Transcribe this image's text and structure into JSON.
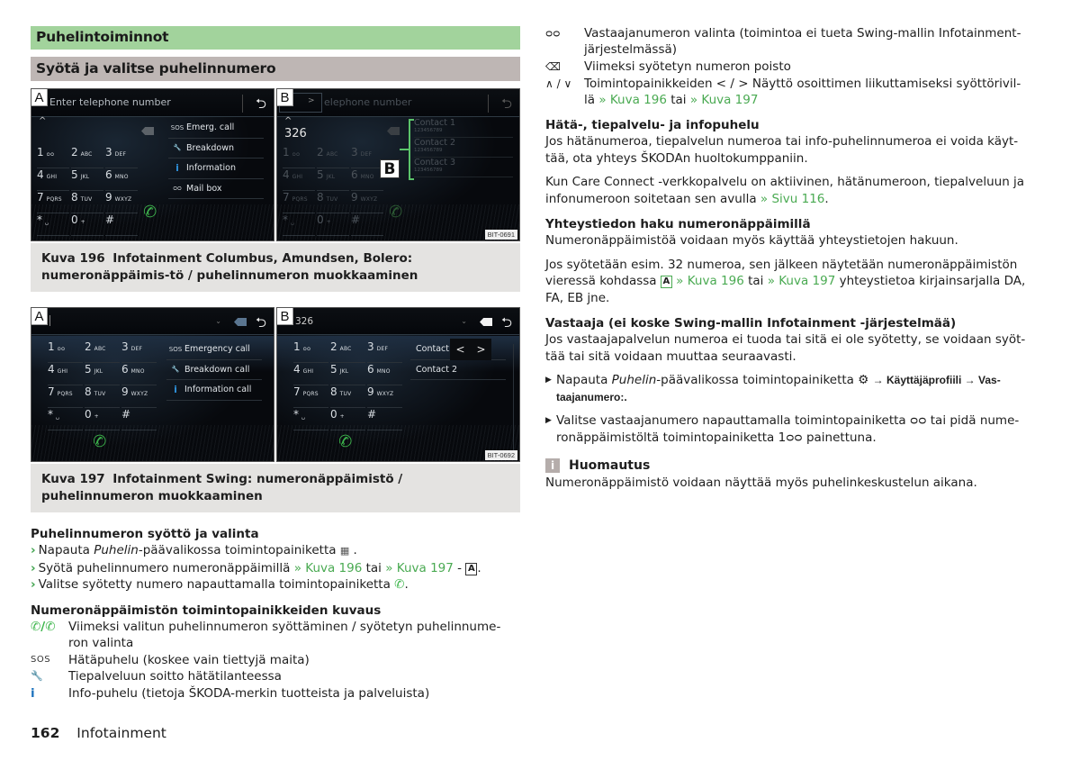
{
  "section": {
    "title": "Puhelintoiminnot",
    "subtitle": "Syötä ja valitse puhelinnumero"
  },
  "figure196": {
    "screenA": {
      "label": "A",
      "input_placeholder": "Enter telephone number",
      "scroll_up": "^",
      "keys": [
        {
          "d": "1",
          "l": "ᴑᴑ"
        },
        {
          "d": "2",
          "l": "ABC"
        },
        {
          "d": "3",
          "l": "DEF"
        },
        {
          "d": "4",
          "l": "GHI"
        },
        {
          "d": "5",
          "l": "JKL"
        },
        {
          "d": "6",
          "l": "MNO"
        },
        {
          "d": "7",
          "l": "PQRS"
        },
        {
          "d": "8",
          "l": "TUV"
        },
        {
          "d": "9",
          "l": "WXYZ"
        },
        {
          "d": "*",
          "l": "␣"
        },
        {
          "d": "0",
          "l": "+"
        },
        {
          "d": "#",
          "l": ""
        }
      ],
      "menu": [
        {
          "icon": "sos-icon",
          "glyph": "SOS",
          "label": "Emerg. call"
        },
        {
          "icon": "wrench-icon",
          "glyph": "🔧",
          "label": "Breakdown"
        },
        {
          "icon": "info-icon",
          "glyph": "i",
          "label": "Information"
        },
        {
          "icon": "voicemail-icon",
          "glyph": "ᴑᴑ",
          "label": "Mail box"
        }
      ]
    },
    "screenB": {
      "label": "B",
      "input_placeholder": "elephone number",
      "cursor_arrow": ">",
      "entered_number": "326",
      "contacts": [
        {
          "name": "Contact 1",
          "number": "123456789"
        },
        {
          "name": "Contact 2",
          "number": "123456789"
        },
        {
          "name": "Contact 3",
          "number": "123456789"
        }
      ],
      "callout": "B",
      "code": "BIT-0691"
    },
    "caption_num": "Kuva 196",
    "caption_text": "Infotainment Columbus, Amundsen, Bolero: numeronäppäimis-tö / puhelinnumeron muokkaaminen"
  },
  "figure197": {
    "screenA": {
      "label": "A",
      "menu": [
        {
          "icon": "sos-icon",
          "glyph": "SOS",
          "label": "Emergency call"
        },
        {
          "icon": "wrench-icon",
          "glyph": "🔧",
          "label": "Breakdown call"
        },
        {
          "icon": "info-icon",
          "glyph": "i",
          "label": "Information call"
        }
      ]
    },
    "screenB": {
      "label": "B",
      "entered_number": "326",
      "contacts": [
        "Contact 1",
        "Contact 2"
      ],
      "nav_prev": "<",
      "nav_next": ">",
      "code": "BIT-0692"
    },
    "caption_num": "Kuva 197",
    "caption_text": "Infotainment Swing: numeronäppäimistö / puhelinnumeron muokkaaminen"
  },
  "entry": {
    "heading": "Puhelinnumeron syöttö ja valinta",
    "steps": [
      {
        "pre": "Napauta ",
        "em": "Puhelin",
        "post": "-päävalikossa toimintopainiketta ",
        "icon": "keypad-icon",
        "end": " ."
      },
      {
        "pre": "Syötä puhelinnumero numeronäppäimillä ",
        "link1": "» Kuva 196",
        "mid": " tai ",
        "link2": "» Kuva 197",
        "post": " - ",
        "box": "A",
        "end": "."
      },
      {
        "pre": "Valitse syötetty numero napauttamalla toimintopainiketta ",
        "icon": "phone-icon",
        "end": "."
      }
    ]
  },
  "desc": {
    "heading": "Numeronäppäimistön toimintopainikkeiden kuvaus",
    "items": [
      {
        "icon": "call-icons",
        "glyph": "✆/✆",
        "text": "Viimeksi valitun puhelinnumeron syöttäminen / syötetyn puhelinnume-ron valinta"
      },
      {
        "icon": "sos-icon",
        "glyph": "SOS",
        "text": "Hätäpuhelu (koskee vain tiettyjä maita)"
      },
      {
        "icon": "wrench-icon",
        "glyph": "🔧",
        "text": "Tiepalveluun soitto hätätilanteessa"
      },
      {
        "icon": "info-icon",
        "glyph": "i",
        "text": "Info-puhelu (tietoja ŠKODA-merkin tuotteista ja palveluista)"
      }
    ]
  },
  "right": {
    "legend": [
      {
        "icon": "voicemail-icon",
        "glyph": "ᴑᴑ",
        "text": "Vastaajanumeron valinta (toimintoa ei tueta Swing-mallin Infotainment-järjestelmässä)"
      },
      {
        "icon": "backspace-icon",
        "glyph": "⌫",
        "text": "Viimeksi syötetyn numeron poisto"
      },
      {
        "icon": "up-down-icon",
        "glyph": "∧ / ∨",
        "text": "Toimintopainikkeiden < / > Näyttö osoittimen liikuttamiseksi syöttörivil-lä ",
        "link1": "» Kuva 196",
        "mid": " tai ",
        "link2": "» Kuva 197"
      }
    ],
    "emergency": {
      "heading": "Hätä-, tiepalvelu- ja infopuhelu",
      "p1": "Jos hätänumeroa, tiepalvelun numeroa tai info-puhelinnumeroa ei voida käyt-tää, ota yhteys ŠKODAn huoltokumppaniin.",
      "p2": "Kun Care Connect -verkkopalvelu on aktiivinen, hätänumeroon, tiepalveluun ja infonumeroon soitetaan sen avulla ",
      "p2_link": "» Sivu 116",
      "p2_end": "."
    },
    "search": {
      "heading": "Yhteystiedon haku numeronäppäimillä",
      "p1": "Numeronäppäimistöä voidaan myös käyttää yhteystietojen hakuun.",
      "p2_pre": "Jos syötetään esim. 32 numeroa, sen jälkeen näytetään numeronäppäimistön vieressä kohdassa ",
      "p2_box": "A",
      "p2_link1": "» Kuva 196",
      "p2_mid": " tai ",
      "p2_link2": "» Kuva 197",
      "p2_post": " yhteystietoa kirjainsarjalla DA, FA, EB jne."
    },
    "voicemail": {
      "heading": "Vastaaja (ei koske Swing-mallin Infotainment -järjestelmää)",
      "p1": "Jos vastaajapalvelun numeroa ei tuoda tai sitä ei ole syötetty, se voidaan syöt-tää tai sitä voidaan muuttaa seuraavasti.",
      "b1_pre": "Napauta ",
      "b1_em": "Puhelin",
      "b1_mid": "-päävalikossa toimintopainiketta ",
      "b1_path": "→ Käyttäjäprofiili → Vas-taajanumero:.",
      "b2": "Valitse vastaajanumero napauttamalla toimintopainiketta ᴑᴑ tai pidä nume-ronäppäimistöltä toimintopainiketta 1ᴑᴑ painettuna."
    },
    "note": {
      "heading": "Huomautus",
      "text": "Numeronäppäimistö voidaan näyttää myös puhelinkeskustelun aikana."
    }
  },
  "footer": {
    "page": "162",
    "chapter": "Infotainment"
  }
}
